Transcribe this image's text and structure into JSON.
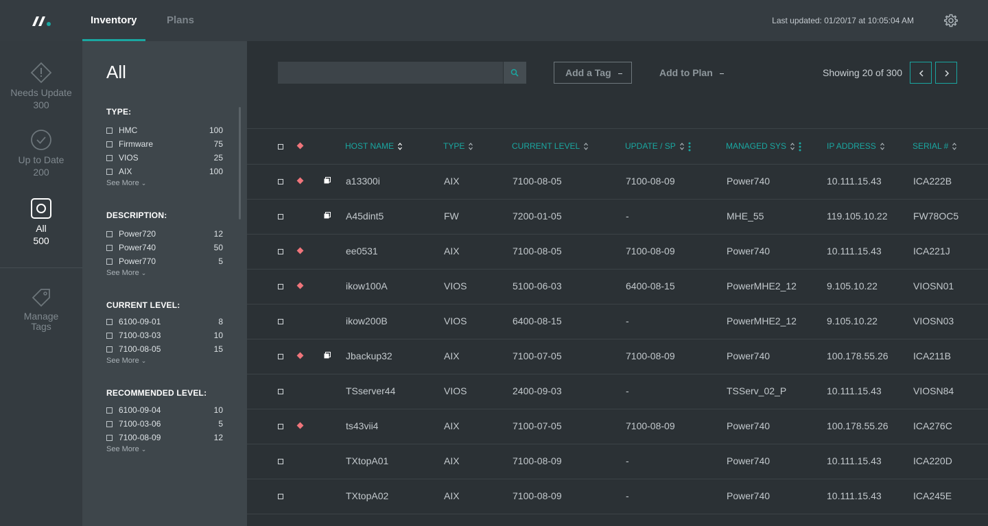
{
  "topbar": {
    "tabs": [
      {
        "label": "Inventory",
        "active": true
      },
      {
        "label": "Plans",
        "active": false
      }
    ],
    "last_updated": "Last updated: 01/20/17 at 10:05:04 AM",
    "accent_color": "#1aa7a1"
  },
  "rail": {
    "items": [
      {
        "label": "Needs Update",
        "count": "300",
        "icon": "alert-diamond-icon"
      },
      {
        "label": "Up to Date",
        "count": "200",
        "icon": "check-circle-icon"
      },
      {
        "label": "All",
        "count": "500",
        "icon": "all-square-icon",
        "active": true
      },
      {
        "label": "Manage Tags",
        "icon": "tag-icon"
      }
    ]
  },
  "filters": {
    "title": "All",
    "see_more": "See More",
    "groups": [
      {
        "title": "TYPE:",
        "options": [
          {
            "label": "HMC",
            "count": "100"
          },
          {
            "label": "Firmware",
            "count": "75"
          },
          {
            "label": "VIOS",
            "count": "25"
          },
          {
            "label": "AIX",
            "count": "100"
          }
        ]
      },
      {
        "title": "DESCRIPTION:",
        "options": [
          {
            "label": "Power720",
            "count": "12"
          },
          {
            "label": "Power740",
            "count": "50"
          },
          {
            "label": "Power770",
            "count": "5"
          }
        ]
      },
      {
        "title": "CURRENT LEVEL:",
        "options": [
          {
            "label": "6100-09-01",
            "count": "8"
          },
          {
            "label": "7100-03-03",
            "count": "10"
          },
          {
            "label": "7100-08-05",
            "count": "15"
          }
        ]
      },
      {
        "title": "RECOMMENDED LEVEL:",
        "options": [
          {
            "label": "6100-09-04",
            "count": "10"
          },
          {
            "label": "7100-03-06",
            "count": "5"
          },
          {
            "label": "7100-08-09",
            "count": "12"
          }
        ]
      }
    ]
  },
  "toolbar": {
    "search_value": "",
    "add_tag": "Add a Tag",
    "add_plan": "Add to Plan",
    "showing": "Showing 20 of 300"
  },
  "table": {
    "columns": [
      "HOST NAME",
      "TYPE",
      "CURRENT LEVEL",
      "UPDATE / SP",
      "MANAGED SYS",
      "IP ADDRESS",
      "SERIAL #"
    ],
    "rows": [
      {
        "needs_update": true,
        "copy": true,
        "host": "a13300i",
        "type": "AIX",
        "current": "7100-08-05",
        "update": "7100-08-09",
        "managed": "Power740",
        "ip": "10.111.15.43",
        "serial": "ICA222B"
      },
      {
        "needs_update": false,
        "copy": true,
        "host": "A45dint5",
        "type": "FW",
        "current": "7200-01-05",
        "update": "-",
        "managed": "MHE_55",
        "ip": "119.105.10.22",
        "serial": "FW78OC5"
      },
      {
        "needs_update": true,
        "copy": false,
        "host": "ee0531",
        "type": "AIX",
        "current": "7100-08-05",
        "update": "7100-08-09",
        "managed": "Power740",
        "ip": "10.111.15.43",
        "serial": "ICA221J"
      },
      {
        "needs_update": true,
        "copy": false,
        "host": "ikow100A",
        "type": "VIOS",
        "current": "5100-06-03",
        "update": "6400-08-15",
        "managed": "PowerMHE2_12",
        "ip": "9.105.10.22",
        "serial": "VIOSN01"
      },
      {
        "needs_update": false,
        "copy": false,
        "host": "ikow200B",
        "type": "VIOS",
        "current": "6400-08-15",
        "update": "-",
        "managed": "PowerMHE2_12",
        "ip": "9.105.10.22",
        "serial": "VIOSN03"
      },
      {
        "needs_update": true,
        "copy": true,
        "host": "Jbackup32",
        "type": "AIX",
        "current": "7100-07-05",
        "update": "7100-08-09",
        "managed": "Power740",
        "ip": "100.178.55.26",
        "serial": "ICA211B"
      },
      {
        "needs_update": false,
        "copy": false,
        "host": "TSserver44",
        "type": "VIOS",
        "current": "2400-09-03",
        "update": "-",
        "managed": "TSServ_02_P",
        "ip": "10.111.15.43",
        "serial": "VIOSN84"
      },
      {
        "needs_update": true,
        "copy": false,
        "host": "ts43vii4",
        "type": "AIX",
        "current": "7100-07-05",
        "update": "7100-08-09",
        "managed": "Power740",
        "ip": "100.178.55.26",
        "serial": "ICA276C"
      },
      {
        "needs_update": false,
        "copy": false,
        "host": "TXtopA01",
        "type": "AIX",
        "current": "7100-08-09",
        "update": "-",
        "managed": "Power740",
        "ip": "10.111.15.43",
        "serial": "ICA220D"
      },
      {
        "needs_update": false,
        "copy": false,
        "host": "TXtopA02",
        "type": "AIX",
        "current": "7100-08-09",
        "update": "-",
        "managed": "Power740",
        "ip": "10.111.15.43",
        "serial": "ICA245E"
      }
    ]
  }
}
